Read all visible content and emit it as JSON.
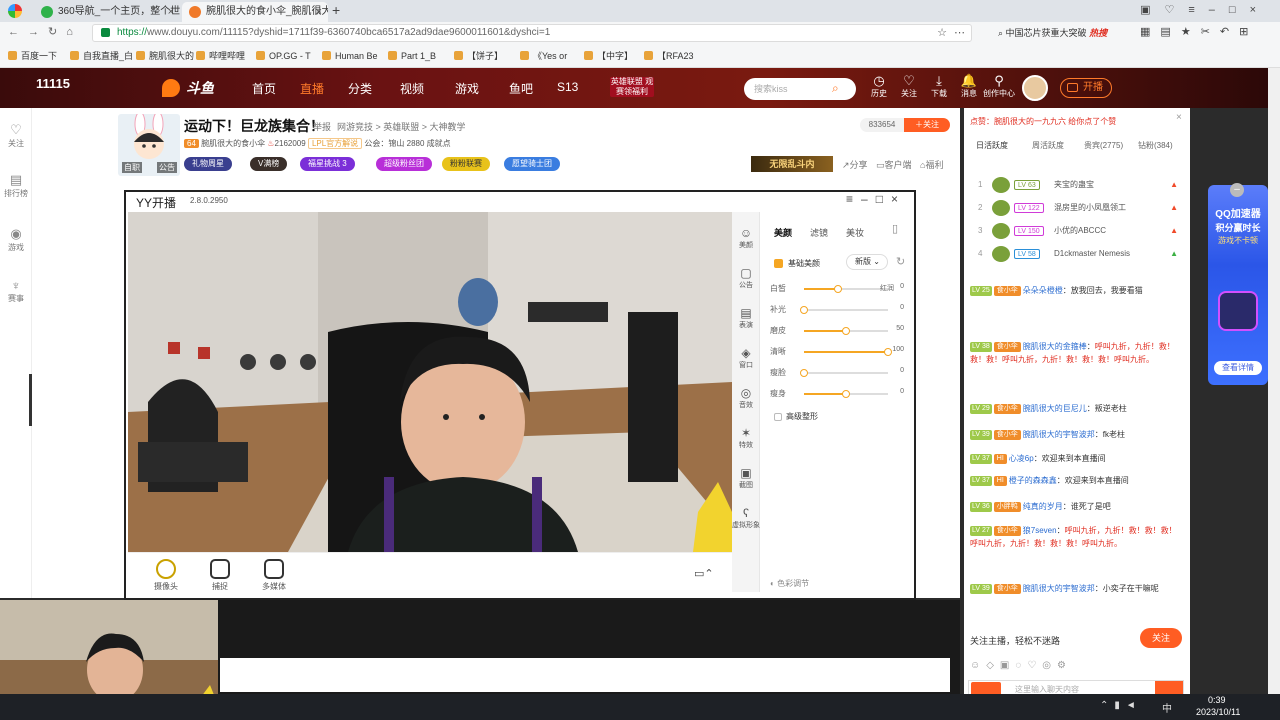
{
  "browser": {
    "tabs": [
      {
        "label": "360导航_一个主页，整个世界",
        "active": false
      },
      {
        "label": "腕肌很大的食小伞_腕肌很大的",
        "active": true
      }
    ],
    "url_scheme": "https://",
    "url_rest": "www.douyu.com/11115?dyshid=1711f39-6360740bca6517a2ad9dae9600011601&dyshci=1",
    "search_hint": "中国芯片获重大突破",
    "search_hot": "热搜",
    "bookmarks": [
      "百度一下",
      "自我直播_白",
      "腕肌很大的",
      "哔哩哔哩",
      "OP.GG - T",
      "Human Be",
      "Part 1_B",
      "【饼子】",
      "《Yes or",
      "【中字】",
      "【RFA23"
    ]
  },
  "douyu": {
    "room_number": "11115",
    "logo": "斗鱼",
    "nav": [
      "首页",
      "直播",
      "分类",
      "视频",
      "游戏",
      "鱼吧",
      "S13"
    ],
    "promo": "英雄联盟 观赛领福利",
    "search_placeholder": "搜索kiss",
    "header_icons": [
      {
        "name": "history-icon",
        "label": "历史"
      },
      {
        "name": "follow-icon",
        "label": "关注"
      },
      {
        "name": "download-icon",
        "label": "下载"
      },
      {
        "name": "message-icon",
        "label": "消息"
      },
      {
        "name": "creator-icon",
        "label": "创作中心"
      }
    ],
    "start_live": "开播"
  },
  "left_sidebar": [
    {
      "icon": "heart-icon",
      "label": "关注"
    },
    {
      "icon": "rank-icon",
      "label": "排行榜"
    },
    {
      "icon": "game-icon",
      "label": "游戏"
    },
    {
      "icon": "trophy-icon",
      "label": "赛事"
    }
  ],
  "room": {
    "title": "运动下！巨龙族集合！",
    "report": "举报",
    "breadcrumb": "网游竞技 > 英雄联盟 > 大神教学",
    "level_badge": "64",
    "streamer": "腕肌很大的食小伞",
    "hot": "2162009",
    "lpl_tag": "LPL官方解说",
    "guild": "公会：锦山",
    "followers": "2880 成就点",
    "fans_count": "833654",
    "follow_btn": "关注",
    "avatar_caption": "自职",
    "notice": "公告",
    "tags": [
      "礼物周星",
      "V满榜",
      "福星挑战 3",
      "超级粉丝团",
      "粉粉联赛",
      "愿望骑士团"
    ],
    "share": "分享",
    "client": "客户端",
    "welfare": "福利",
    "banner": "无限乱斗内"
  },
  "yy": {
    "app_title": "YY开播",
    "version": "2.8.0.2950",
    "side_items": [
      "美颜",
      "公告",
      "表演",
      "窗口",
      "音效",
      "特效",
      "截图",
      "虚拟形象"
    ],
    "tabs": [
      "美颜",
      "滤镜",
      "美妆"
    ],
    "beauty_toggle": "基础美颜",
    "preset": "新版",
    "sliders": [
      {
        "label": "白皙",
        "value": 0,
        "pos": 0.4,
        "right": "红润"
      },
      {
        "label": "补光",
        "value": 0,
        "pos": 0.0,
        "right": ""
      },
      {
        "label": "磨皮",
        "value": 50,
        "pos": 0.5,
        "right": ""
      },
      {
        "label": "清晰",
        "value": 100,
        "pos": 1.0,
        "right": ""
      },
      {
        "label": "瘦脸",
        "value": 0,
        "pos": 0.0,
        "right": ""
      },
      {
        "label": "瘦身",
        "value": 0,
        "pos": 0.5,
        "right": ""
      }
    ],
    "advanced": "高级整形",
    "color_adjust": "色彩调节",
    "bottom": [
      "摄像头",
      "捕捉",
      "多媒体"
    ]
  },
  "chat": {
    "gift_notice": "点赞：腕肌很大的一九九六 给你点了个赞",
    "rank_tabs": [
      "日活跃度",
      "周活跃度",
      "贵宾(2775)",
      "钻粉(384)"
    ],
    "ranks": [
      {
        "rank": "1",
        "lv": "LV 63",
        "name": "夹宝的蛊宝",
        "lv_color": "#7aa03a"
      },
      {
        "rank": "2",
        "lv": "LV 122",
        "name": "混房里的小凤凰领工",
        "lv_color": "#d03bd8"
      },
      {
        "rank": "3",
        "lv": "LV 150",
        "name": "小优的ABCCC",
        "lv_color": "#d03bd8"
      },
      {
        "rank": "4",
        "lv": "LV 58",
        "name": "D1ckmaster Nemesis",
        "lv_color": "#2a8fd8"
      }
    ],
    "messages": [
      {
        "lv": "LV 25",
        "badge": "食小伞",
        "user": "朵朵朵橙橙",
        "text": "放我回去，我要看猫"
      },
      {
        "lv": "LV 38",
        "badge": "食小伞",
        "user": "腕肌很大的金箍棒",
        "text": "呼叫九折，九折！救！救！救！呼叫九折，九折！救！救！救！呼叫九折。",
        "red": true
      },
      {
        "lv": "LV 29",
        "badge": "食小伞",
        "user": "腕肌很大的巨尼儿",
        "text": "叛逆老柱"
      },
      {
        "lv": "LV 39",
        "badge": "食小伞",
        "user": "腕肌很大的宇智波邦",
        "text": "fk老柱"
      },
      {
        "lv": "LV 37",
        "badge": "HI",
        "user": "心凌6p",
        "text": "欢迎来到本直播间"
      },
      {
        "lv": "LV 37",
        "badge": "HI",
        "user": "橙子的森森鑫",
        "text": "欢迎来到本直播间"
      },
      {
        "lv": "LV 36",
        "badge": "小胖鸭",
        "user": "纯真的岁月",
        "text": "谁死了是吧"
      },
      {
        "lv": "LV 27",
        "badge": "食小伞",
        "user": "狼7seven",
        "text": "呼叫九折，九折！救！救！救！呼叫九折，九折！救！救！救！呼叫九折。",
        "red": true
      },
      {
        "lv": "LV 39",
        "badge": "食小伞",
        "user": "腕肌很大的宇智波邦",
        "text": "小奕子在干嘛呢"
      }
    ],
    "follow_prompt": "关注主播，轻松不迷路",
    "follow_btn": "关注",
    "input_placeholder": "这里输入聊天内容"
  },
  "ad": {
    "title": "QQ加速器",
    "subtitle": "积分赢时长",
    "line": "游戏不卡顿",
    "cta": "查看详情"
  },
  "taskbar": {
    "time": "0:39",
    "date": "2023/10/11",
    "ime": "中"
  }
}
